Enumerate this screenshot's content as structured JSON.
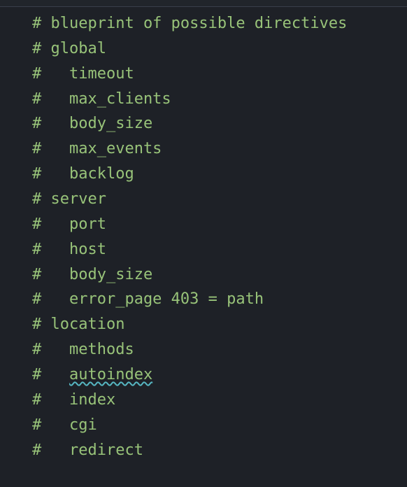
{
  "code": {
    "lines": [
      {
        "text": "# blueprint of possible directives",
        "squiggly": null
      },
      {
        "text": "# global",
        "squiggly": null
      },
      {
        "text": "#   timeout",
        "squiggly": null
      },
      {
        "text": "#   max_clients",
        "squiggly": null
      },
      {
        "text": "#   body_size",
        "squiggly": null
      },
      {
        "text": "#   max_events",
        "squiggly": null
      },
      {
        "text": "#   backlog",
        "squiggly": null
      },
      {
        "text": "# server",
        "squiggly": null
      },
      {
        "text": "#   port",
        "squiggly": null
      },
      {
        "text": "#   host",
        "squiggly": null
      },
      {
        "text": "#   body_size",
        "squiggly": null
      },
      {
        "text": "#   error_page 403 = path",
        "squiggly": null
      },
      {
        "text": "# location",
        "squiggly": null
      },
      {
        "text": "#   methods",
        "squiggly": null
      },
      {
        "text": "#   ",
        "squiggly": "autoindex"
      },
      {
        "text": "#   index",
        "squiggly": null
      },
      {
        "text": "#   cgi",
        "squiggly": null
      },
      {
        "text": "#   redirect",
        "squiggly": null
      }
    ]
  }
}
